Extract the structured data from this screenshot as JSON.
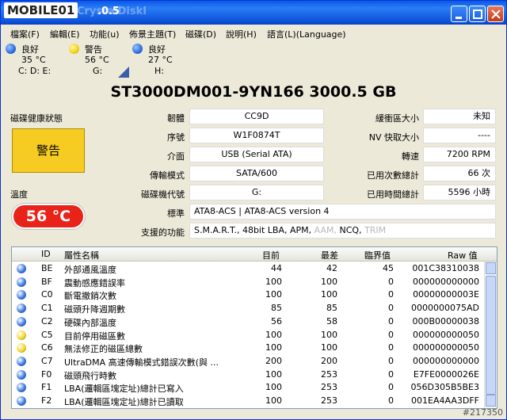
{
  "app": {
    "logo_text": "MOBILE01",
    "title": ".0.5",
    "title_partial": "CrystalDiskI"
  },
  "menu": [
    "檔案(F)",
    "編輯(E)",
    "功能(u)",
    "佈景主題(T)",
    "磁碟(D)",
    "說明(H)",
    "語言(L)(Language)"
  ],
  "drives": [
    {
      "status": "良好",
      "temp": "35 °C",
      "letter": "C: D: E:",
      "color": "#2d6fe0"
    },
    {
      "status": "警告",
      "temp": "56 °C",
      "letter": "G:",
      "color": "#f2d21c"
    },
    {
      "status": "良好",
      "temp": "27 °C",
      "letter": "H:",
      "color": "#2d6fe0"
    }
  ],
  "disk": {
    "model": "ST3000DM001-9YN166  3000.5 GB",
    "health_label": "磁碟健康狀態",
    "health_value": "警告",
    "temp_label": "溫度",
    "temp_value": "56 °C",
    "fields": {
      "firmware_label": "韌體",
      "firmware": "CC9D",
      "serial_label": "序號",
      "serial": "W1F0874T",
      "interface_label": "介面",
      "interface": "USB (Serial ATA)",
      "transfer_label": "傳輸模式",
      "transfer": "SATA/600",
      "letter_label": "磁碟機代號",
      "letter": "G:",
      "buffer_label": "緩衝區大小",
      "buffer": "未知",
      "nv_label": "NV 快取大小",
      "nv": "----",
      "rpm_label": "轉速",
      "rpm": "7200 RPM",
      "power_count_label": "已用次數總計",
      "power_count": "66 次",
      "power_hours_label": "已用時間總計",
      "power_hours": "5596 小時",
      "standard_label": "標準",
      "standard": "ATA8-ACS | ATA8-ACS version 4",
      "features_label": "支援的功能",
      "features_active": "S.M.A.R.T., 48bit LBA, APM,",
      "features_aam": "AAM,",
      "features_ncq": "NCQ,",
      "features_trim": "TRIM"
    }
  },
  "table": {
    "headers": {
      "id": "ID",
      "name": "屬性名稱",
      "current": "目前",
      "worst": "最差",
      "threshold": "臨界值",
      "raw": "Raw 值"
    },
    "rows": [
      {
        "color": "#2d6fe0",
        "id": "BE",
        "name": "外部通風溫度",
        "current": "44",
        "worst": "42",
        "threshold": "45",
        "raw": "001C38310038"
      },
      {
        "color": "#2d6fe0",
        "id": "BF",
        "name": "震動感應錯誤率",
        "current": "100",
        "worst": "100",
        "threshold": "0",
        "raw": "000000000000"
      },
      {
        "color": "#2d6fe0",
        "id": "C0",
        "name": "斷電撤銷次數",
        "current": "100",
        "worst": "100",
        "threshold": "0",
        "raw": "00000000003E"
      },
      {
        "color": "#2d6fe0",
        "id": "C1",
        "name": "磁頭升降週期數",
        "current": "85",
        "worst": "85",
        "threshold": "0",
        "raw": "0000000075AD"
      },
      {
        "color": "#2d6fe0",
        "id": "C2",
        "name": "硬碟內部溫度",
        "current": "56",
        "worst": "58",
        "threshold": "0",
        "raw": "000B00000038"
      },
      {
        "color": "#f2d21c",
        "id": "C5",
        "name": "目前停用磁區數",
        "current": "100",
        "worst": "100",
        "threshold": "0",
        "raw": "000000000050"
      },
      {
        "color": "#f2d21c",
        "id": "C6",
        "name": "無法修正的磁區總數",
        "current": "100",
        "worst": "100",
        "threshold": "0",
        "raw": "000000000050"
      },
      {
        "color": "#2d6fe0",
        "id": "C7",
        "name": "UltraDMA 高速傳輸模式錯誤次數(與 ...",
        "current": "200",
        "worst": "200",
        "threshold": "0",
        "raw": "000000000000"
      },
      {
        "color": "#2d6fe0",
        "id": "F0",
        "name": "磁頭飛行時數",
        "current": "100",
        "worst": "253",
        "threshold": "0",
        "raw": "E7FE0000026E"
      },
      {
        "color": "#2d6fe0",
        "id": "F1",
        "name": "LBA(邏輯區塊定址)總計已寫入",
        "current": "100",
        "worst": "253",
        "threshold": "0",
        "raw": "056D305B5BE3"
      },
      {
        "color": "#2d6fe0",
        "id": "F2",
        "name": "LBA(邏輯區塊定址)總計已讀取",
        "current": "100",
        "worst": "253",
        "threshold": "0",
        "raw": "001EA4AA3DFF"
      }
    ]
  },
  "watermark": "#217350"
}
